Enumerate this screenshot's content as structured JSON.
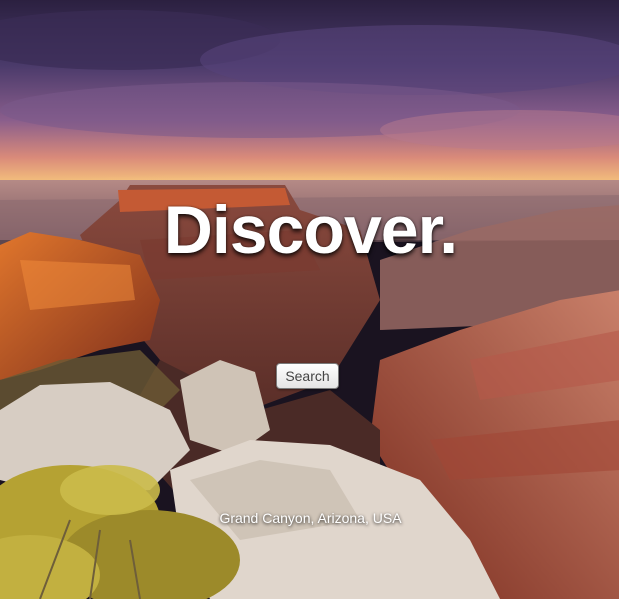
{
  "hero": {
    "headline": "Discover.",
    "search_label": "Search",
    "location": "Grand Canyon, Arizona, USA"
  },
  "colors": {
    "sky_top": "#2b2040",
    "sky_mid": "#6a4f8a",
    "horizon": "#f4b060",
    "rock_red": "#a8432a",
    "rock_orange": "#d86a26",
    "foreground_rock": "#d9cfc4",
    "shrub": "#b7a52f"
  },
  "icons": {
    "background": "landscape-photo"
  }
}
